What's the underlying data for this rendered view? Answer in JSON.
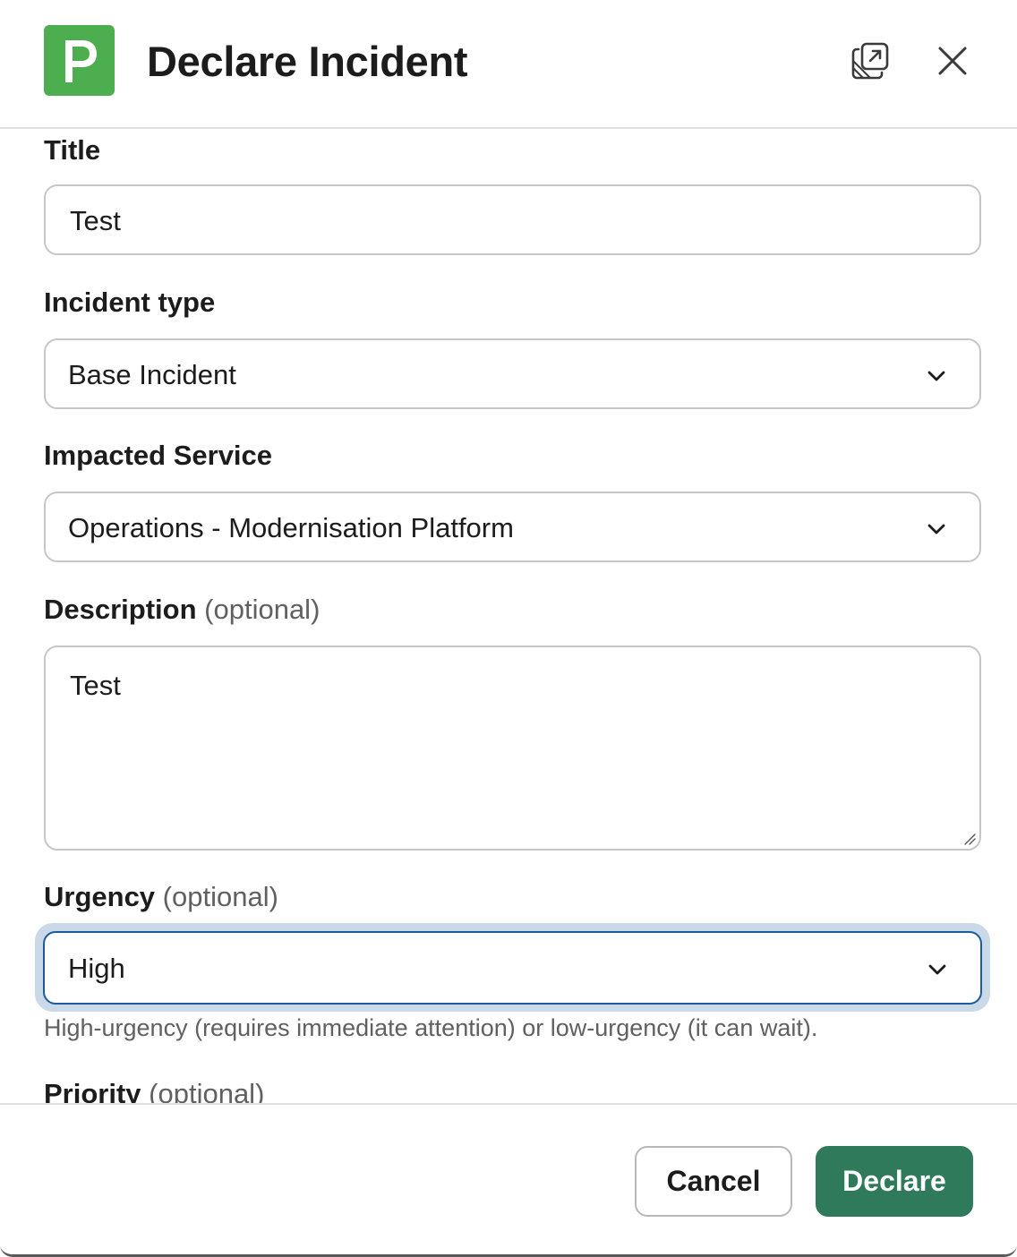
{
  "header": {
    "title": "Declare Incident",
    "logo_icon": "pagerduty-logo-icon",
    "logo_color": "#4cae4f",
    "popout_icon": "popout-window-icon",
    "close_icon": "close-icon"
  },
  "form": {
    "title": {
      "label": "Title",
      "value": "Test"
    },
    "incident_type": {
      "label": "Incident type",
      "value": "Base Incident"
    },
    "impacted_service": {
      "label": "Impacted Service",
      "value": "Operations - Modernisation Platform"
    },
    "description": {
      "label": "Description",
      "optional": "(optional)",
      "value": "Test"
    },
    "urgency": {
      "label": "Urgency",
      "optional": "(optional)",
      "value": "High",
      "hint": "High-urgency (requires immediate attention) or low-urgency (it can wait)."
    },
    "priority": {
      "label": "Priority",
      "optional": "(optional)"
    }
  },
  "footer": {
    "cancel_label": "Cancel",
    "declare_label": "Declare",
    "declare_color": "#2f7a5a"
  }
}
